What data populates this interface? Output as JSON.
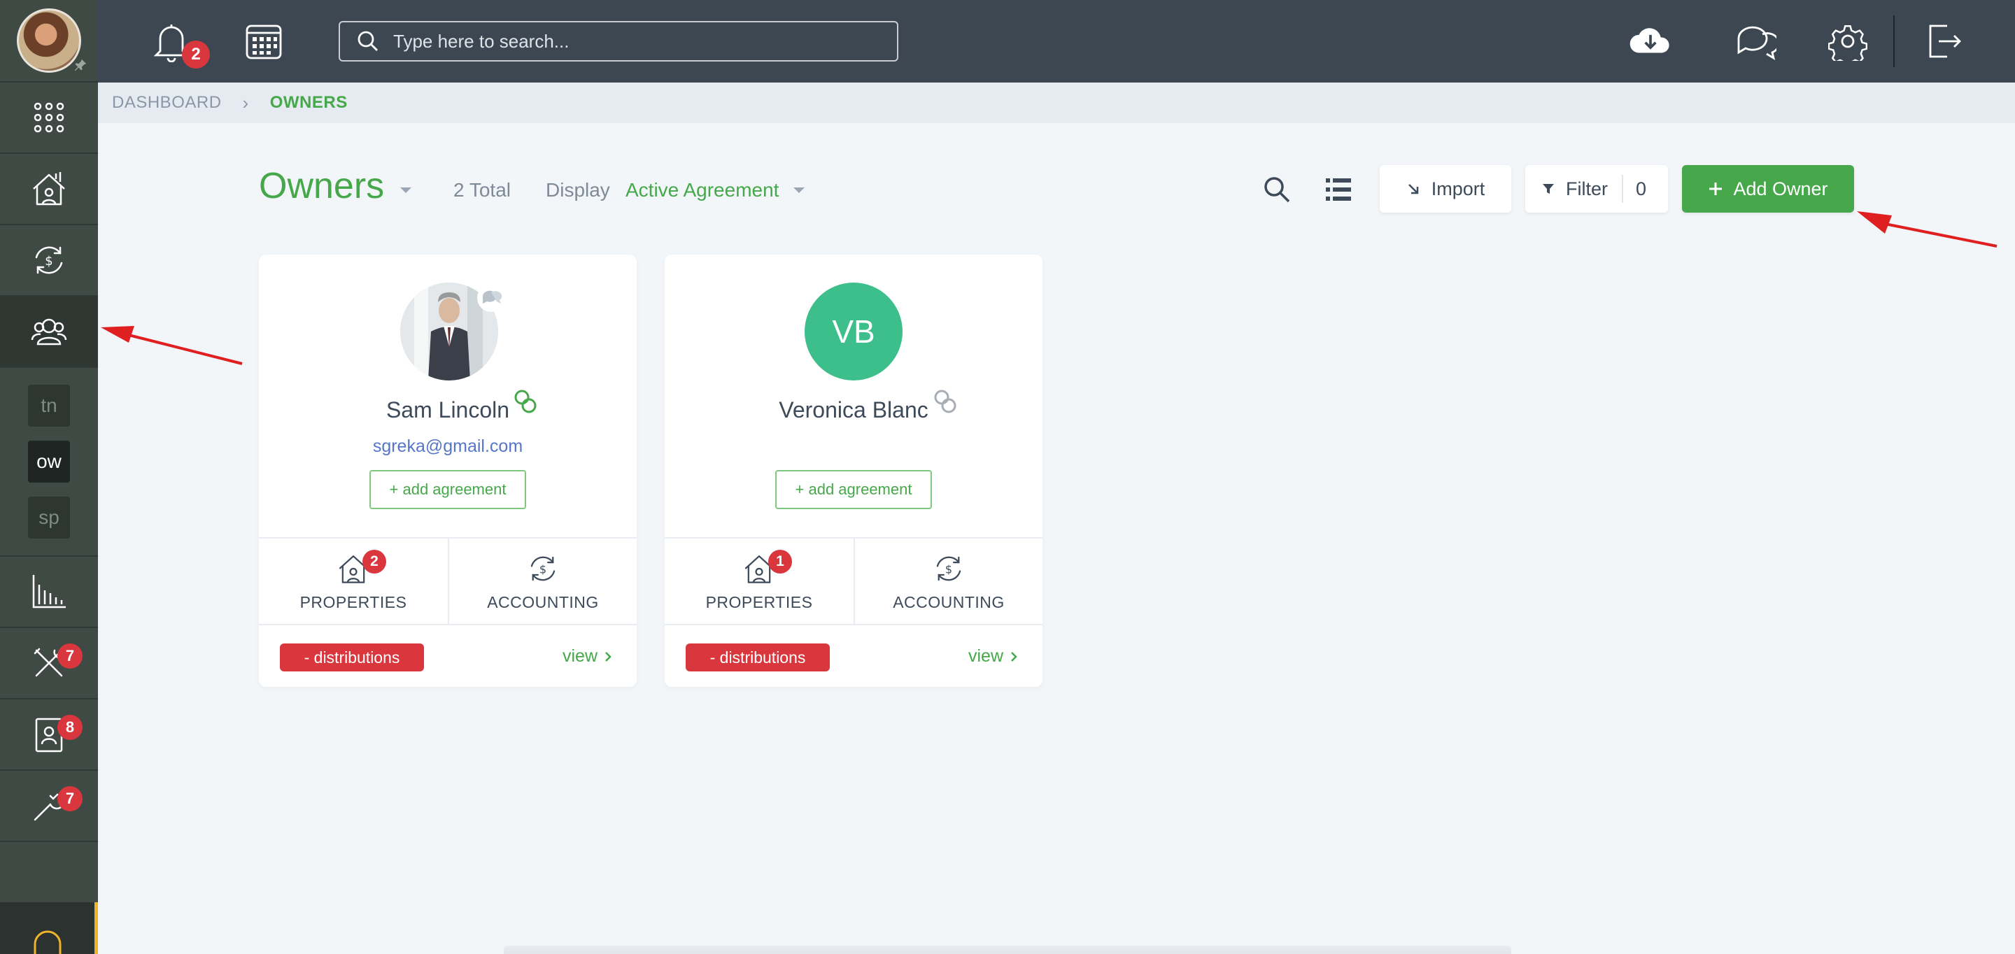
{
  "topbar": {
    "notification_count": "2",
    "search_placeholder": "Type here to search..."
  },
  "sidebar": {
    "sub_items": [
      "tn",
      "ow",
      "sp"
    ],
    "maintenance_count": "7",
    "tenants_count": "8",
    "tools_count": "7"
  },
  "breadcrumb": {
    "home": "DASHBOARD",
    "current": "OWNERS"
  },
  "header": {
    "title": "Owners",
    "total": "2 Total",
    "display_label": "Display",
    "display_value": "Active Agreement",
    "import_label": "Import",
    "filter_label": "Filter",
    "filter_count": "0",
    "add_label": "Add Owner"
  },
  "owners": [
    {
      "name": "Sam Lincoln",
      "email": "sgreka@gmail.com",
      "add_agreement": "+ add agreement",
      "properties_label": "PROPERTIES",
      "properties_count": "2",
      "accounting_label": "ACCOUNTING",
      "distributions": "- distributions",
      "view": "view"
    },
    {
      "name": "Veronica Blanc",
      "initials": "VB",
      "add_agreement": "+ add agreement",
      "properties_label": "PROPERTIES",
      "properties_count": "1",
      "accounting_label": "ACCOUNTING",
      "distributions": "- distributions",
      "view": "view"
    }
  ],
  "colors": {
    "accent": "#46a84a",
    "danger": "#d9363e",
    "topbar": "#3c4752",
    "sidebar": "#404a45",
    "annotation_arrow": "#e02020"
  }
}
